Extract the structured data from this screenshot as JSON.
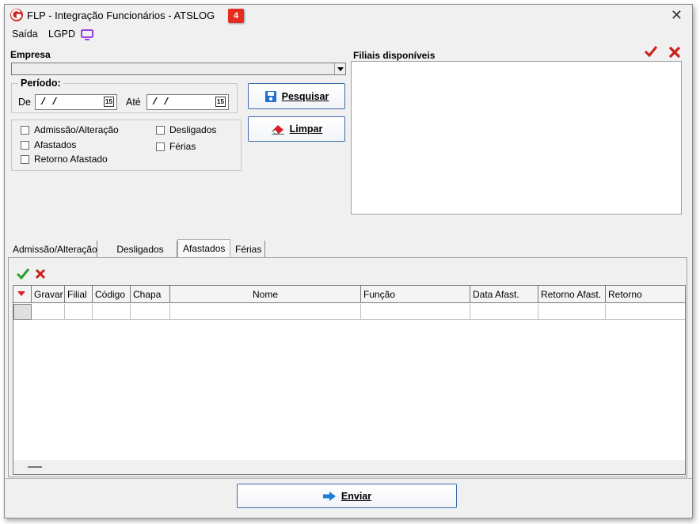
{
  "window": {
    "title": "FLP - Integração Funcionários - ATSLOG",
    "badge": "4"
  },
  "menu": {
    "items": [
      "Saída",
      "LGPD"
    ]
  },
  "empresa": {
    "label": "Empresa",
    "value": ""
  },
  "periodo": {
    "label": "Período:",
    "de_label": "De",
    "de_value": "/ /",
    "ate_label": "Até",
    "ate_value": "/ /",
    "cal_text": "15"
  },
  "buttons": {
    "pesquisar": "Pesquisar",
    "limpar": "Limpar",
    "enviar": "Enviar"
  },
  "checkboxes": [
    {
      "label": "Admissão/Alteração",
      "checked": false
    },
    {
      "label": "Afastados",
      "checked": false
    },
    {
      "label": "Retorno Afastado",
      "checked": false
    },
    {
      "label": "Desligados",
      "checked": false
    },
    {
      "label": "Férias",
      "checked": false
    }
  ],
  "filiais": {
    "label": "Filiais disponíveis"
  },
  "tabs": [
    "Admissão/Alteração",
    "Desligados",
    "Afastados",
    "Férias"
  ],
  "active_tab": "Afastados",
  "grid": {
    "columns": [
      "Gravar",
      "Filial",
      "Código",
      "Chapa",
      "Nome",
      "Função",
      "Data Afast.",
      "Retorno Afast.",
      "Retorno"
    ]
  },
  "colors": {
    "accent_red": "#cc1f1a",
    "check_green": "#2a9d2a",
    "button_border": "#3c6aa8",
    "badge": "#e52d1f"
  }
}
